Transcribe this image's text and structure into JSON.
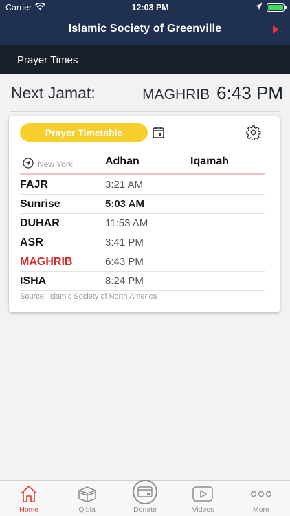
{
  "status": {
    "carrier": "Carrier",
    "time": "12:03 PM"
  },
  "header": {
    "title": "Islamic Society of Greenville"
  },
  "subbar": {
    "title": "Prayer Times"
  },
  "next_jamat": {
    "label": "Next Jamat:",
    "prayer": "MAGHRIB",
    "time": "6:43 PM"
  },
  "card": {
    "timetable_button": "Prayer Timetable",
    "location": "New York",
    "col_adhan": "Adhan",
    "col_iqamah": "Iqamah",
    "rows": [
      {
        "name": "FAJR",
        "adhan": "3:21 AM",
        "iqamah": ""
      },
      {
        "name": "Sunrise",
        "adhan": "5:03 AM",
        "iqamah": ""
      },
      {
        "name": "DUHAR",
        "adhan": "11:53 AM",
        "iqamah": ""
      },
      {
        "name": "ASR",
        "adhan": "3:41 PM",
        "iqamah": ""
      },
      {
        "name": "MAGHRIB",
        "adhan": "6:43 PM",
        "iqamah": ""
      },
      {
        "name": "ISHA",
        "adhan": "8:24 PM",
        "iqamah": ""
      }
    ],
    "source": "Source: Islamic Society of North America"
  },
  "tabs": [
    {
      "label": "Home",
      "icon": "home-icon",
      "active": true
    },
    {
      "label": "Qibla",
      "icon": "kaaba-icon",
      "active": false
    },
    {
      "label": "Donate",
      "icon": "credit-card-icon",
      "active": false
    },
    {
      "label": "Videos",
      "icon": "play-icon",
      "active": false
    },
    {
      "label": "More",
      "icon": "more-dots-icon",
      "active": false
    }
  ],
  "colors": {
    "header": "#1f3050",
    "subbar": "#1a1f2c",
    "accent": "#e8332f",
    "button": "#f6cf2c",
    "current_prayer": "#d92a2a"
  }
}
